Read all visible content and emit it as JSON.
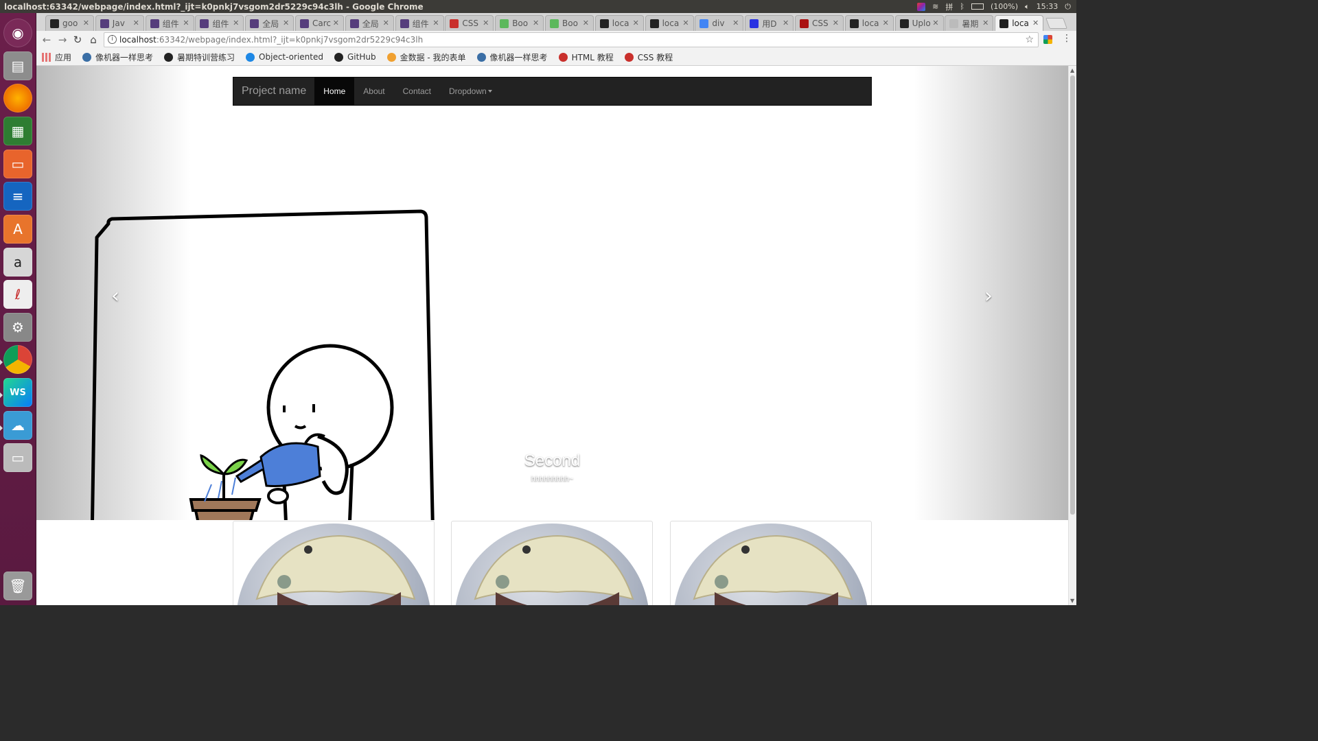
{
  "window": {
    "title": "localhost:63342/webpage/index.html?_ijt=k0pnkj7vsgom2dr5229c94c3lh - Google Chrome",
    "tray": {
      "input_method": "拼",
      "battery": "(100%)",
      "clock": "15:33"
    }
  },
  "tabs": [
    {
      "label": "goo",
      "icon": "github-icon",
      "color": "#222"
    },
    {
      "label": "Jav",
      "icon": "bootstrap-icon",
      "color": "#563d7c"
    },
    {
      "label": "组件",
      "icon": "bootstrap-icon",
      "color": "#563d7c"
    },
    {
      "label": "组件",
      "icon": "bootstrap-icon",
      "color": "#563d7c"
    },
    {
      "label": "全局",
      "icon": "bootstrap-icon",
      "color": "#563d7c"
    },
    {
      "label": "Carc",
      "icon": "bootstrap-icon",
      "color": "#563d7c"
    },
    {
      "label": "全局",
      "icon": "bootstrap-icon",
      "color": "#563d7c"
    },
    {
      "label": "组件",
      "icon": "bootstrap-icon",
      "color": "#563d7c"
    },
    {
      "label": "CSS",
      "icon": "runoob-icon",
      "color": "#c9302c"
    },
    {
      "label": "Boo",
      "icon": "gitbook-icon",
      "color": "#5cb85c"
    },
    {
      "label": "Boo",
      "icon": "gitbook-icon",
      "color": "#5cb85c"
    },
    {
      "label": "loca",
      "icon": "webstorm-icon",
      "color": "#222"
    },
    {
      "label": "loca",
      "icon": "webstorm-icon",
      "color": "#222"
    },
    {
      "label": "div",
      "icon": "google-icon",
      "color": "#4285f4"
    },
    {
      "label": "用D",
      "icon": "baidu-icon",
      "color": "#2932e1"
    },
    {
      "label": "CSS",
      "icon": "css-icon",
      "color": "#a11"
    },
    {
      "label": "loca",
      "icon": "webstorm-icon",
      "color": "#222"
    },
    {
      "label": "Uplo",
      "icon": "github-icon",
      "color": "#222"
    },
    {
      "label": "暑期",
      "icon": "doc-icon",
      "color": "#bbb"
    },
    {
      "label": "loca",
      "icon": "webstorm-icon",
      "color": "#222"
    }
  ],
  "address": {
    "host": "localhost",
    "rest": ":63342/webpage/index.html?_ijt=k0pnkj7vsgom2dr5229c94c3lh"
  },
  "bookmarks": [
    {
      "label": "应用",
      "icon": "apps-grid-icon",
      "color": "#e57373"
    },
    {
      "label": "像机器一样思考",
      "icon": "blog-icon",
      "color": "#3a6ea5"
    },
    {
      "label": "暑期特训营练习",
      "icon": "bookmark-icon",
      "color": "#222"
    },
    {
      "label": "Object-oriented",
      "icon": "bookmark-icon",
      "color": "#1e88e5"
    },
    {
      "label": "GitHub",
      "icon": "github-icon",
      "color": "#222"
    },
    {
      "label": "金数据 - 我的表单",
      "icon": "jinshuju-icon",
      "color": "#f0a030"
    },
    {
      "label": "像机器一样思考",
      "icon": "blog-icon",
      "color": "#3a6ea5"
    },
    {
      "label": "HTML 教程",
      "icon": "runoob-icon",
      "color": "#c9302c"
    },
    {
      "label": "CSS 教程",
      "icon": "runoob-icon",
      "color": "#c9302c"
    }
  ],
  "navbar": {
    "brand": "Project name",
    "items": [
      {
        "label": "Home",
        "active": true
      },
      {
        "label": "About",
        "active": false
      },
      {
        "label": "Contact",
        "active": false
      },
      {
        "label": "Dropdown",
        "active": false
      }
    ]
  },
  "carousel": {
    "caption_title": "Second",
    "caption_text": "hhhhhhhhh~",
    "prev_glyph": "‹",
    "next_glyph": "›"
  }
}
